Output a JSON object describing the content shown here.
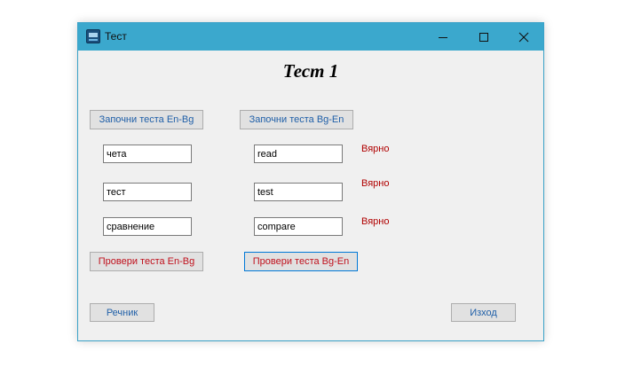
{
  "window": {
    "title": "Тест",
    "icon": "app-icon"
  },
  "heading": "Тест 1",
  "buttons": {
    "start_en_bg": "Започни теста En-Bg",
    "start_bg_en": "Започни теста Bg-En",
    "check_en_bg": "Провери теста En-Bg",
    "check_bg_en": "Провери теста Bg-En",
    "dictionary": "Речник",
    "exit": "Изход"
  },
  "words": [
    {
      "bg": "чета",
      "en": "read",
      "result": "Вярно"
    },
    {
      "bg": "тест",
      "en": "test",
      "result": "Вярно"
    },
    {
      "bg": "сравнение",
      "en": "compare",
      "result": "Вярно"
    }
  ],
  "colors": {
    "titlebar": "#3ba8cd",
    "button_text_blue": "#1f5fa8",
    "button_text_red": "#c0101c",
    "result_red": "#b00000",
    "window_bg": "#f0f0f0"
  }
}
